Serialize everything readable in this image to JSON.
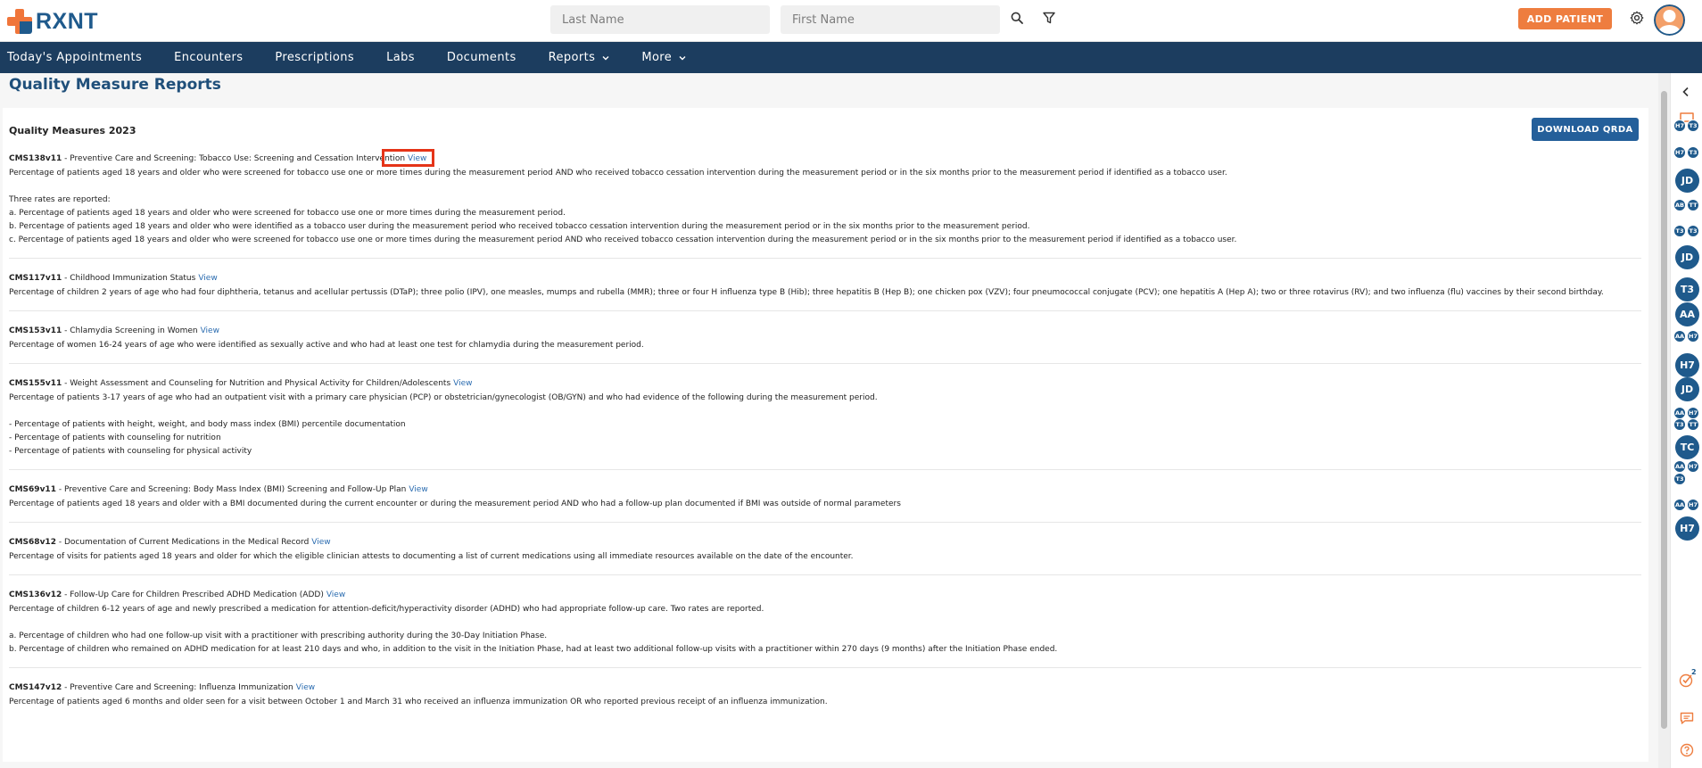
{
  "header": {
    "logo_text": "RXNT",
    "last_name_placeholder": "Last Name",
    "first_name_placeholder": "First Name",
    "add_patient_label": "ADD PATIENT"
  },
  "nav": {
    "items": [
      {
        "label": "Today's Appointments"
      },
      {
        "label": "Encounters"
      },
      {
        "label": "Prescriptions"
      },
      {
        "label": "Labs"
      },
      {
        "label": "Documents"
      },
      {
        "label": "Reports"
      },
      {
        "label": "More"
      }
    ]
  },
  "page": {
    "title": "Quality Measure Reports",
    "section_title": "Quality Measures 2023",
    "download_label": "DOWNLOAD QRDA",
    "view_label": "View"
  },
  "measures": [
    {
      "code": "CMS138v11",
      "title": "Preventive Care and Screening: Tobacco Use: Screening and Cessation Intervention",
      "lines": [
        "Percentage of patients aged 18 years and older who were screened for tobacco use one or more times during the measurement period AND who received tobacco cessation intervention during the measurement period or in the six months prior to the measurement period if identified as a tobacco user.",
        "",
        "Three rates are reported:",
        "a. Percentage of patients aged 18 years and older who were screened for tobacco use one or more times during the measurement period.",
        "b. Percentage of patients aged 18 years and older who were identified as a tobacco user during the measurement period who received tobacco cessation intervention during the measurement period or in the six months prior to the measurement period.",
        "c. Percentage of patients aged 18 years and older who were screened for tobacco use one or more times during the measurement period AND who received tobacco cessation intervention during the measurement period or in the six months prior to the measurement period if identified as a tobacco user."
      ]
    },
    {
      "code": "CMS117v11",
      "title": "Childhood Immunization Status",
      "lines": [
        "Percentage of children 2 years of age who had four diphtheria, tetanus and acellular pertussis (DTaP); three polio (IPV), one measles, mumps and rubella (MMR); three or four H influenza type B (Hib); three hepatitis B (Hep B); one chicken pox (VZV); four pneumococcal conjugate (PCV); one hepatitis A (Hep A); two or three rotavirus (RV); and two influenza (flu) vaccines by their second birthday."
      ]
    },
    {
      "code": "CMS153v11",
      "title": "Chlamydia Screening in Women",
      "lines": [
        "Percentage of women 16-24 years of age who were identified as sexually active and who had at least one test for chlamydia during the measurement period."
      ]
    },
    {
      "code": "CMS155v11",
      "title": "Weight Assessment and Counseling for Nutrition and Physical Activity for Children/Adolescents",
      "lines": [
        "Percentage of patients 3-17 years of age who had an outpatient visit with a primary care physician (PCP) or obstetrician/gynecologist (OB/GYN) and who had evidence of the following during the measurement period.",
        "",
        "- Percentage of patients with height, weight, and body mass index (BMI) percentile documentation",
        "- Percentage of patients with counseling for nutrition",
        "- Percentage of patients with counseling for physical activity"
      ]
    },
    {
      "code": "CMS69v11",
      "title": "Preventive Care and Screening: Body Mass Index (BMI) Screening and Follow-Up Plan",
      "lines": [
        "Percentage of patients aged 18 years and older with a BMI documented during the current encounter or during the measurement period AND who had a follow-up plan documented if BMI was outside of normal parameters"
      ]
    },
    {
      "code": "CMS68v12",
      "title": "Documentation of Current Medications in the Medical Record",
      "lines": [
        "Percentage of visits for patients aged 18 years and older for which the eligible clinician attests to documenting a list of current medications using all immediate resources available on the date of the encounter."
      ]
    },
    {
      "code": "CMS136v12",
      "title": "Follow-Up Care for Children Prescribed ADHD Medication (ADD)",
      "lines": [
        "Percentage of children 6-12 years of age and newly prescribed a medication for attention-deficit/hyperactivity disorder (ADHD) who had appropriate follow-up care. Two rates are reported.",
        "",
        "a. Percentage of children who had one follow-up visit with a practitioner with prescribing authority during the 30-Day Initiation Phase.",
        "b. Percentage of children who remained on ADHD medication for at least 210 days and who, in addition to the visit in the Initiation Phase, had at least two additional follow-up visits with a practitioner within 270 days (9 months) after the Initiation Phase ended."
      ]
    },
    {
      "code": "CMS147v12",
      "title": "Preventive Care and Screening: Influenza Immunization",
      "lines": [
        "Percentage of patients aged 6 months and older seen for a visit between October 1 and March 31 who received an influenza immunization OR who reported previous receipt of an influenza immunization."
      ]
    }
  ],
  "rail": {
    "notification_count": "2",
    "bubbles": [
      {
        "type": "pair",
        "labels": [
          "H7",
          "T3"
        ]
      },
      {
        "type": "pair",
        "labels": [
          "H7",
          "T3"
        ]
      },
      {
        "type": "single",
        "label": "JD"
      },
      {
        "type": "pair",
        "labels": [
          "AB",
          "TT"
        ]
      },
      {
        "type": "pair",
        "labels": [
          "T3",
          "T3"
        ]
      },
      {
        "type": "single",
        "label": "JD"
      },
      {
        "type": "single",
        "label": "T3"
      },
      {
        "type": "single",
        "label": "AA"
      },
      {
        "type": "pair",
        "labels": [
          "AA",
          "H7"
        ]
      },
      {
        "type": "single",
        "label": "H7"
      },
      {
        "type": "single",
        "label": "JD"
      },
      {
        "type": "pair",
        "labels": [
          "AA",
          "H7"
        ]
      },
      {
        "type": "pair",
        "labels": [
          "T3",
          "TT"
        ]
      },
      {
        "type": "single",
        "label": "TC"
      },
      {
        "type": "pair",
        "labels": [
          "AA",
          "H7"
        ]
      },
      {
        "type": "pair",
        "labels": [
          "T3",
          ""
        ]
      },
      {
        "type": "pair",
        "labels": [
          "AA",
          "H7"
        ]
      },
      {
        "type": "single",
        "label": "H7"
      }
    ],
    "colors": {
      "accent": "#ee7d3f",
      "brand": "#1f5a8c",
      "nav": "#1c3d5f"
    }
  }
}
